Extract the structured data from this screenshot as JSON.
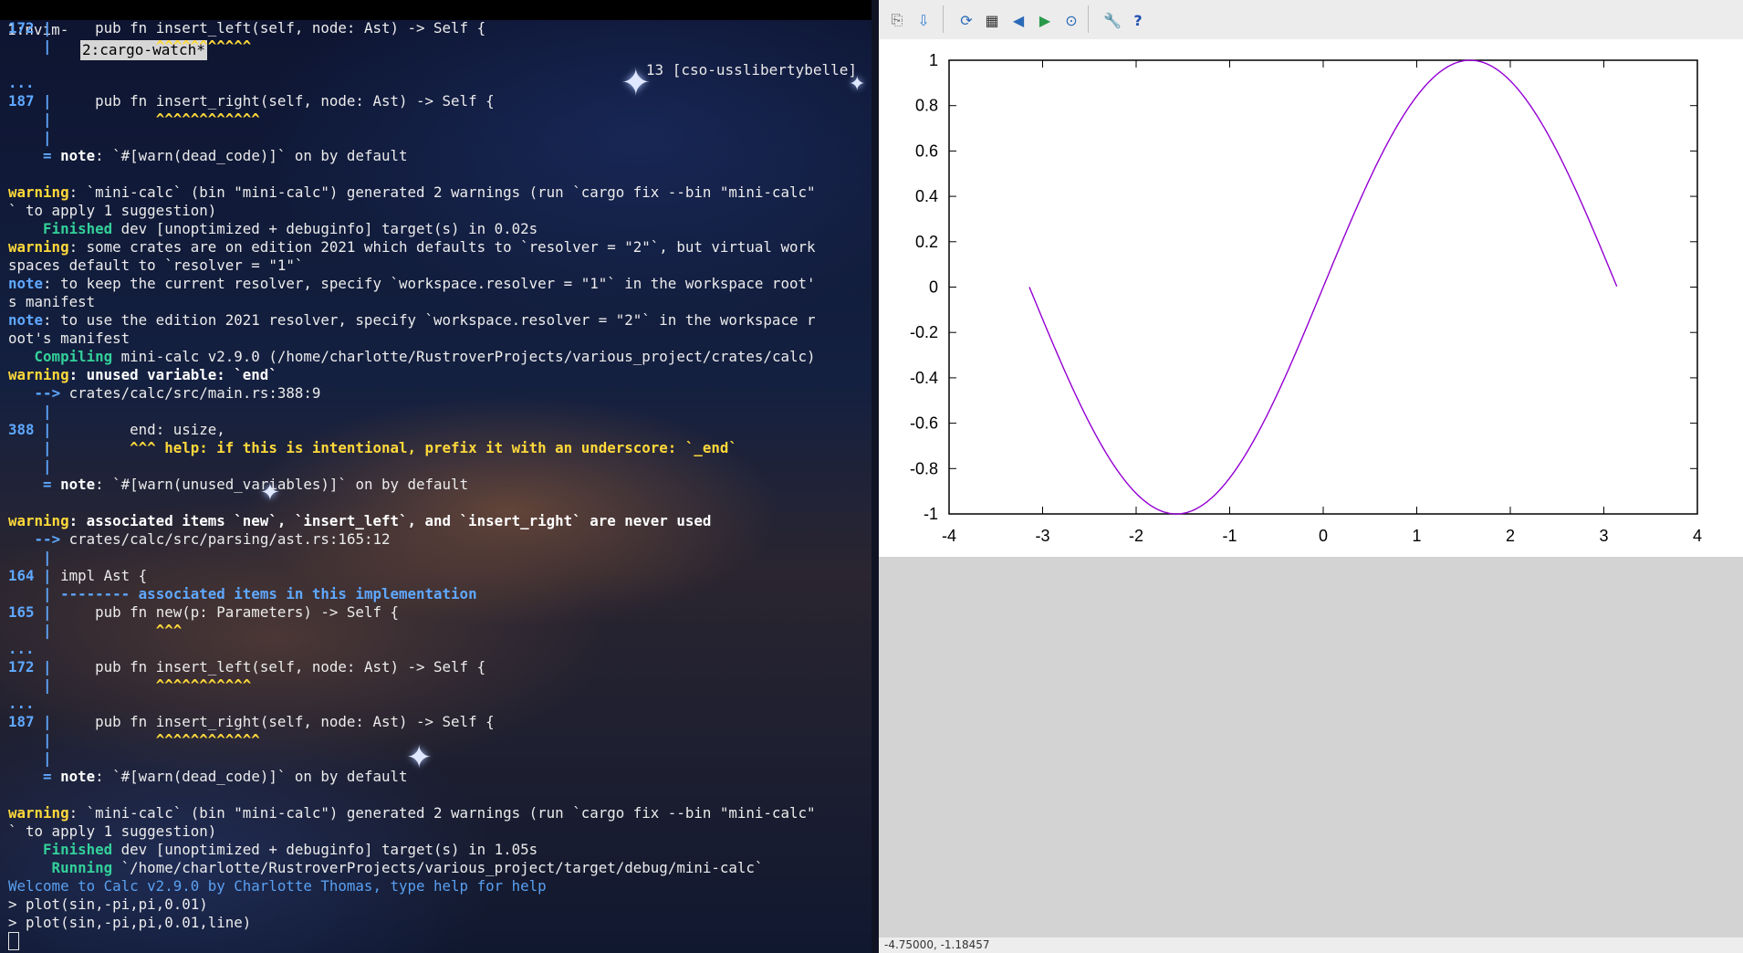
{
  "tmux": {
    "window1": "1:nvim-",
    "window2": "2:cargo-watch*",
    "session": "13 [cso-usslibertybelle]"
  },
  "terminal": {
    "lines": [
      [
        {
          "c": "lnum",
          "t": "172 "
        },
        {
          "c": "pipe",
          "t": "|"
        },
        {
          "t": "     pub fn insert_left(self, node: Ast) -> Self {"
        }
      ],
      [
        {
          "t": "    "
        },
        {
          "c": "pipe",
          "t": "|"
        },
        {
          "c": "yel",
          "t": "            ^^^^^^^^^^^"
        }
      ],
      [
        {
          "c": "pipe",
          "t": ""
        }
      ],
      [
        {
          "c": "pipe",
          "t": "..."
        }
      ],
      [
        {
          "c": "lnum",
          "t": "187 "
        },
        {
          "c": "pipe",
          "t": "|"
        },
        {
          "t": "     pub fn insert_right(self, node: Ast) -> Self {"
        }
      ],
      [
        {
          "t": "    "
        },
        {
          "c": "pipe",
          "t": "|"
        },
        {
          "c": "yel",
          "t": "            ^^^^^^^^^^^^"
        }
      ],
      [
        {
          "t": "    "
        },
        {
          "c": "pipe",
          "t": "|"
        }
      ],
      [
        {
          "t": "    "
        },
        {
          "c": "pipe",
          "t": "= "
        },
        {
          "c": "bold",
          "t": "note"
        },
        {
          "t": ": `#[warn(dead_code)]` on by default"
        }
      ],
      [
        {
          "t": ""
        }
      ],
      [
        {
          "c": "warn",
          "t": "warning"
        },
        {
          "t": ": `mini-calc` (bin \"mini-calc\") generated 2 warnings (run `cargo fix --bin \"mini-calc\""
        }
      ],
      [
        {
          "t": "` to apply 1 suggestion)"
        }
      ],
      [
        {
          "c": "grn",
          "t": "    Finished"
        },
        {
          "t": " dev [unoptimized + debuginfo] target(s) in 0.02s"
        }
      ],
      [
        {
          "c": "warn",
          "t": "warning"
        },
        {
          "t": ": some crates are on edition 2021 which defaults to `resolver = \"2\"`, but virtual work"
        }
      ],
      [
        {
          "t": "spaces default to `resolver = \"1\"`"
        }
      ],
      [
        {
          "c": "note",
          "t": "note"
        },
        {
          "t": ": to keep the current resolver, specify `workspace.resolver = \"1\"` in the workspace root'"
        }
      ],
      [
        {
          "t": "s manifest"
        }
      ],
      [
        {
          "c": "note",
          "t": "note"
        },
        {
          "t": ": to use the edition 2021 resolver, specify `workspace.resolver = \"2\"` in the workspace r"
        }
      ],
      [
        {
          "t": "oot's manifest"
        }
      ],
      [
        {
          "c": "grn",
          "t": "   Compiling"
        },
        {
          "t": " mini-calc v2.9.0 (/home/charlotte/RustroverProjects/various_project/crates/calc)"
        }
      ],
      [
        {
          "c": "warn",
          "t": "warning"
        },
        {
          "c": "bold",
          "t": ": unused variable: `end`"
        }
      ],
      [
        {
          "t": "   "
        },
        {
          "c": "pipe",
          "t": "-->"
        },
        {
          "t": " crates/calc/src/main.rs:388:9"
        }
      ],
      [
        {
          "t": "    "
        },
        {
          "c": "pipe",
          "t": "|"
        }
      ],
      [
        {
          "c": "lnum",
          "t": "388 "
        },
        {
          "c": "pipe",
          "t": "|"
        },
        {
          "t": "         end: usize,"
        }
      ],
      [
        {
          "t": "    "
        },
        {
          "c": "pipe",
          "t": "|"
        },
        {
          "c": "yel",
          "t": "         ^^^ help: if this is intentional, prefix it with an underscore: `_end`"
        }
      ],
      [
        {
          "t": "    "
        },
        {
          "c": "pipe",
          "t": "|"
        }
      ],
      [
        {
          "t": "    "
        },
        {
          "c": "pipe",
          "t": "= "
        },
        {
          "c": "bold",
          "t": "note"
        },
        {
          "t": ": `#[warn(unused_variables)]` on by default"
        }
      ],
      [
        {
          "t": ""
        }
      ],
      [
        {
          "c": "warn",
          "t": "warning"
        },
        {
          "c": "bold",
          "t": ": associated items `new`, `insert_left`, and `insert_right` are never used"
        }
      ],
      [
        {
          "t": "   "
        },
        {
          "c": "pipe",
          "t": "-->"
        },
        {
          "t": " crates/calc/src/parsing/ast.rs:165:12"
        }
      ],
      [
        {
          "t": "    "
        },
        {
          "c": "pipe",
          "t": "|"
        }
      ],
      [
        {
          "c": "lnum",
          "t": "164 "
        },
        {
          "c": "pipe",
          "t": "|"
        },
        {
          "t": " impl Ast {"
        }
      ],
      [
        {
          "t": "    "
        },
        {
          "c": "pipe",
          "t": "|"
        },
        {
          "c": "blu",
          "t": " -------- associated items in this implementation"
        }
      ],
      [
        {
          "c": "lnum",
          "t": "165 "
        },
        {
          "c": "pipe",
          "t": "|"
        },
        {
          "t": "     pub fn new(p: Parameters) -> Self {"
        }
      ],
      [
        {
          "t": "    "
        },
        {
          "c": "pipe",
          "t": "|"
        },
        {
          "c": "yel",
          "t": "            ^^^"
        }
      ],
      [
        {
          "c": "pipe",
          "t": "..."
        }
      ],
      [
        {
          "c": "lnum",
          "t": "172 "
        },
        {
          "c": "pipe",
          "t": "|"
        },
        {
          "t": "     pub fn insert_left(self, node: Ast) -> Self {"
        }
      ],
      [
        {
          "t": "    "
        },
        {
          "c": "pipe",
          "t": "|"
        },
        {
          "c": "yel",
          "t": "            ^^^^^^^^^^^"
        }
      ],
      [
        {
          "c": "pipe",
          "t": "..."
        }
      ],
      [
        {
          "c": "lnum",
          "t": "187 "
        },
        {
          "c": "pipe",
          "t": "|"
        },
        {
          "t": "     pub fn insert_right(self, node: Ast) -> Self {"
        }
      ],
      [
        {
          "t": "    "
        },
        {
          "c": "pipe",
          "t": "|"
        },
        {
          "c": "yel",
          "t": "            ^^^^^^^^^^^^"
        }
      ],
      [
        {
          "t": "    "
        },
        {
          "c": "pipe",
          "t": "|"
        }
      ],
      [
        {
          "t": "    "
        },
        {
          "c": "pipe",
          "t": "= "
        },
        {
          "c": "bold",
          "t": "note"
        },
        {
          "t": ": `#[warn(dead_code)]` on by default"
        }
      ],
      [
        {
          "t": ""
        }
      ],
      [
        {
          "c": "warn",
          "t": "warning"
        },
        {
          "t": ": `mini-calc` (bin \"mini-calc\") generated 2 warnings (run `cargo fix --bin \"mini-calc\""
        }
      ],
      [
        {
          "t": "` to apply 1 suggestion)"
        }
      ],
      [
        {
          "c": "grn",
          "t": "    Finished"
        },
        {
          "t": " dev [unoptimized + debuginfo] target(s) in 1.05s"
        }
      ],
      [
        {
          "c": "grn",
          "t": "     Running"
        },
        {
          "t": " `/home/charlotte/RustroverProjects/various_project/target/debug/mini-calc`"
        }
      ],
      [
        {
          "c": "welcome",
          "t": "Welcome to Calc v2.9.0 by Charlotte Thomas, type help for help"
        }
      ],
      [
        {
          "t": "> plot(sin,-pi,pi,0.01)"
        }
      ],
      [
        {
          "t": "> plot(sin,-pi,pi,0.01,line)"
        }
      ]
    ]
  },
  "toolbar": {
    "buttons": [
      {
        "name": "copy-clipboard-icon",
        "glyph": "⎘"
      },
      {
        "name": "replot-mouse-icon",
        "glyph": "⇩"
      },
      {
        "name": "replot-icon",
        "glyph": "⟳"
      },
      {
        "name": "grid-icon",
        "glyph": "▦"
      },
      {
        "name": "zoom-previous-icon",
        "glyph": "◀"
      },
      {
        "name": "zoom-next-icon",
        "glyph": "▶"
      },
      {
        "name": "autoscale-icon",
        "glyph": "⊙"
      },
      {
        "name": "settings-icon",
        "glyph": "🔧"
      },
      {
        "name": "help-icon",
        "glyph": "?"
      }
    ]
  },
  "status": {
    "coords": "-4.75000, -1.18457"
  },
  "chart_data": {
    "type": "line",
    "function": "sin",
    "x_start": -3.14159,
    "x_end": 3.14159,
    "step": 0.01,
    "xlim": [
      -4,
      4
    ],
    "ylim": [
      -1,
      1
    ],
    "xticks": [
      "-4",
      "-3",
      "-2",
      "-1",
      "0",
      "1",
      "2",
      "3",
      "4"
    ],
    "yticks": [
      "1",
      "0.8",
      "0.6",
      "0.4",
      "0.2",
      "0",
      "-0.2",
      "-0.4",
      "-0.6",
      "-0.8",
      "-1"
    ],
    "line_color": "#9400d3",
    "grid": false,
    "title": "",
    "xlabel": "",
    "ylabel": ""
  }
}
